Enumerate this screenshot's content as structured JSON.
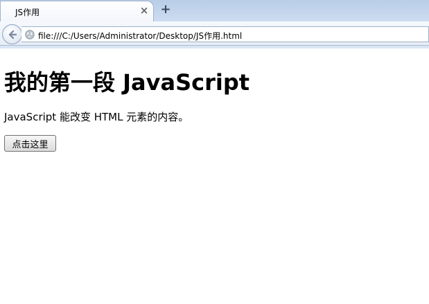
{
  "browser": {
    "tab_title": "JS作用",
    "tab_close": "×",
    "new_tab": "+",
    "address": "file:///C:/Users/Administrator/Desktop/JS作用.html"
  },
  "page": {
    "heading": "我的第一段 JavaScript",
    "paragraph": "JavaScript 能改变 HTML 元素的内容。",
    "button_label": "点击这里"
  }
}
